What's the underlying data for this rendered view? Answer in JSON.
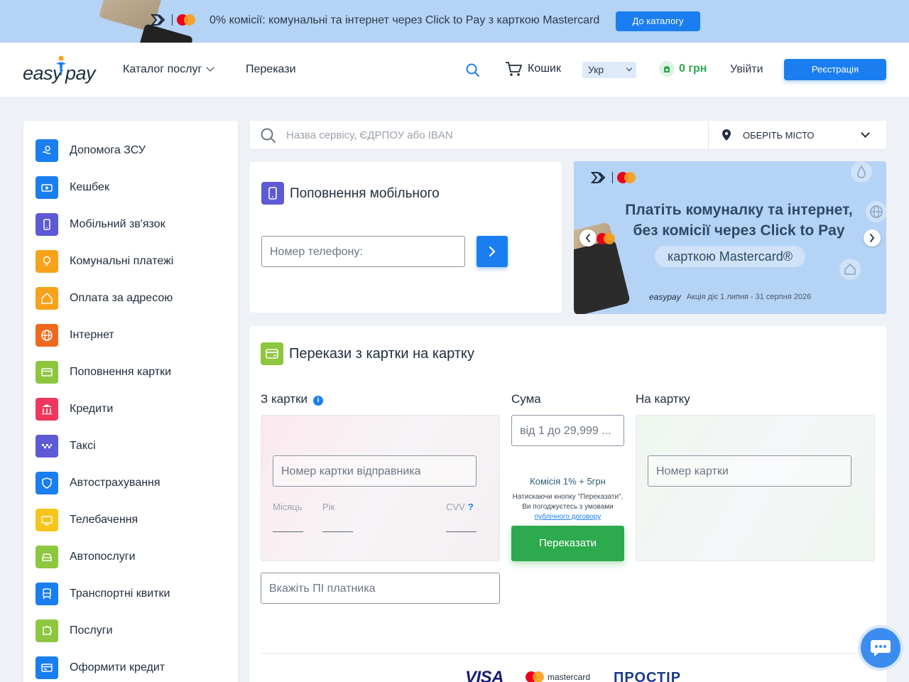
{
  "promo": {
    "text": "0% комісії: комунальні та інтернет через Click to Pay з карткою Mastercard",
    "button": "До каталогу"
  },
  "header": {
    "logo_left": "easy",
    "logo_right": "pay",
    "nav": [
      "Каталог послуг",
      "Перекази"
    ],
    "cart": "Кошик",
    "lang": "Укр",
    "balance": "0 грн",
    "login": "Увійти",
    "register": "Реєстрація"
  },
  "sidebar": {
    "items": [
      {
        "label": "Допомога ЗСУ",
        "color": "#1a7ef0",
        "icon": "hand-heart-icon"
      },
      {
        "label": "Кешбек",
        "color": "#1a7ef0",
        "icon": "cash-icon"
      },
      {
        "label": "Мобільний зв'язок",
        "color": "#5e5ad6",
        "icon": "phone-icon"
      },
      {
        "label": "Комунальні платежі",
        "color": "#f7a21b",
        "icon": "bulb-icon"
      },
      {
        "label": "Оплата за адресою",
        "color": "#f7a21b",
        "icon": "home-icon"
      },
      {
        "label": "Інтернет",
        "color": "#f06a1e",
        "icon": "globe-icon"
      },
      {
        "label": "Поповнення картки",
        "color": "#8dc63f",
        "icon": "card-plus-icon"
      },
      {
        "label": "Кредити",
        "color": "#f0365a",
        "icon": "bank-icon"
      },
      {
        "label": "Таксі",
        "color": "#5e5ad6",
        "icon": "taxi-icon"
      },
      {
        "label": "Автострахування",
        "color": "#1a7ef0",
        "icon": "car-shield-icon"
      },
      {
        "label": "Телебачення",
        "color": "#f7c51b",
        "icon": "tv-icon"
      },
      {
        "label": "Автопослуги",
        "color": "#8dc63f",
        "icon": "car-icon"
      },
      {
        "label": "Транспортні квитки",
        "color": "#1a7ef0",
        "icon": "train-icon"
      },
      {
        "label": "Послуги",
        "color": "#8dc63f",
        "icon": "puzzle-icon"
      },
      {
        "label": "Оформити кредит",
        "color": "#1a7ef0",
        "icon": "credit-card-icon"
      }
    ]
  },
  "search": {
    "placeholder": "Назва сервісу, ЄДРПОУ або IBAN",
    "city": "ОБЕРІТЬ МІСТО"
  },
  "mobile": {
    "title": "Поповнення мобільного",
    "placeholder": "Номер телефону:"
  },
  "banner": {
    "headline_1": "Платіть комуналку та інтернет,",
    "headline_2": "без комісії через Click to Pay",
    "pill": "карткою Mastercard®",
    "footer_logo": "easypay",
    "footer_text": "Акція діє 1 липня - 31 серпня 2026"
  },
  "transfer": {
    "title": "Перекази з картки на картку",
    "from_label": "З картки",
    "sum_label": "Сума",
    "to_label": "На картку",
    "from_placeholder": "Номер картки відправника",
    "month": "Місяць",
    "year": "Рік",
    "cvv": "CVV",
    "sum_placeholder": "від 1 до 29,999 ...",
    "fee": "Комісія 1% + 5грн",
    "terms": "Натискаючи кнопку \"Переказати\", Ви погоджуєтесь з умовами",
    "terms_link": "публічного договору",
    "send": "Переказати",
    "to_placeholder": "Номер картки",
    "payer_placeholder": "Вкажіть ПІ платника",
    "visa": "VISA",
    "mastercard": "mastercard",
    "prostir": "ПРОСТІР"
  }
}
